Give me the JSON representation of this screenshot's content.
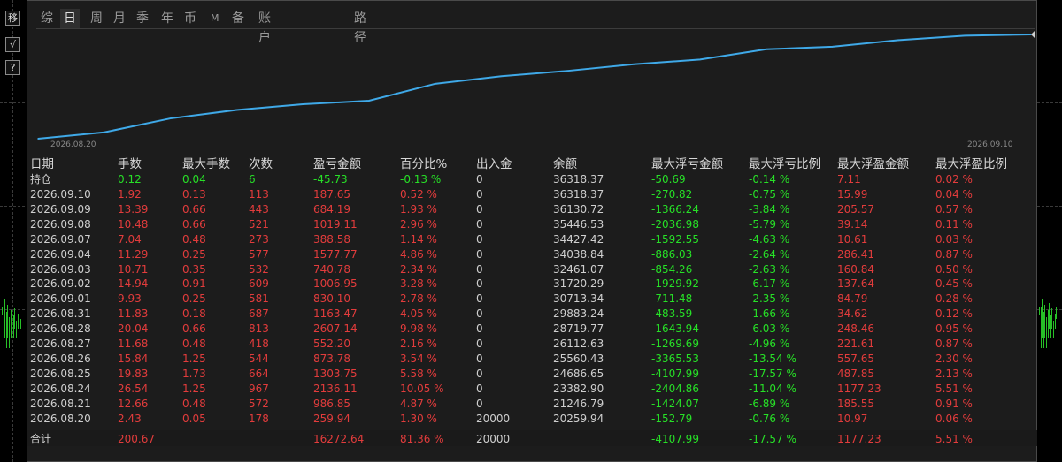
{
  "tabs": [
    "综",
    "日",
    "周",
    "月",
    "季",
    "年",
    "币",
    "M",
    "备",
    "账户",
    "路径"
  ],
  "active_tab": "日",
  "side_icons": [
    "移",
    "√",
    "?"
  ],
  "chart_data": {
    "type": "line",
    "x": [
      "2026.08.20",
      "2026.08.21",
      "2026.08.24",
      "2026.08.25",
      "2026.08.26",
      "2026.08.27",
      "2026.08.28",
      "2026.08.31",
      "2026.09.01",
      "2026.09.02",
      "2026.09.03",
      "2026.09.04",
      "2026.09.07",
      "2026.09.08",
      "2026.09.09",
      "2026.09.10"
    ],
    "values": [
      20259.94,
      21246.79,
      23382.9,
      24686.65,
      25560.43,
      26112.63,
      28719.77,
      29883.24,
      30713.34,
      31720.29,
      32461.07,
      34038.84,
      34427.42,
      35446.53,
      36130.72,
      36318.37
    ],
    "x_start_label": "2026.08.20",
    "x_end_label": "2026.09.10",
    "color": "#3fa9e8"
  },
  "table": {
    "headers": [
      "日期",
      "手数",
      "最大手数",
      "次数",
      "盈亏金额",
      "百分比%",
      "出入金",
      "余额",
      "最大浮亏金额",
      "最大浮亏比例",
      "最大浮盈金额",
      "最大浮盈比例"
    ],
    "position_row": [
      "持仓",
      "0.12",
      "0.04",
      "6",
      "-45.73",
      "-0.13 %",
      "0",
      "36318.37",
      "-50.69",
      "-0.14 %",
      "7.11",
      "0.02 %"
    ],
    "rows": [
      [
        "2026.09.10",
        "1.92",
        "0.13",
        "113",
        "187.65",
        "0.52 %",
        "0",
        "36318.37",
        "-270.82",
        "-0.75 %",
        "15.99",
        "0.04 %"
      ],
      [
        "2026.09.09",
        "13.39",
        "0.66",
        "443",
        "684.19",
        "1.93 %",
        "0",
        "36130.72",
        "-1366.24",
        "-3.84 %",
        "205.57",
        "0.57 %"
      ],
      [
        "2026.09.08",
        "10.48",
        "0.66",
        "521",
        "1019.11",
        "2.96 %",
        "0",
        "35446.53",
        "-2036.98",
        "-5.79 %",
        "39.14",
        "0.11 %"
      ],
      [
        "2026.09.07",
        "7.04",
        "0.48",
        "273",
        "388.58",
        "1.14 %",
        "0",
        "34427.42",
        "-1592.55",
        "-4.63 %",
        "10.61",
        "0.03 %"
      ],
      [
        "2026.09.04",
        "11.29",
        "0.25",
        "577",
        "1577.77",
        "4.86 %",
        "0",
        "34038.84",
        "-886.03",
        "-2.64 %",
        "286.41",
        "0.87 %"
      ],
      [
        "2026.09.03",
        "10.71",
        "0.35",
        "532",
        "740.78",
        "2.34 %",
        "0",
        "32461.07",
        "-854.26",
        "-2.63 %",
        "160.84",
        "0.50 %"
      ],
      [
        "2026.09.02",
        "14.94",
        "0.91",
        "609",
        "1006.95",
        "3.28 %",
        "0",
        "31720.29",
        "-1929.92",
        "-6.17 %",
        "137.64",
        "0.45 %"
      ],
      [
        "2026.09.01",
        "9.93",
        "0.25",
        "581",
        "830.10",
        "2.78 %",
        "0",
        "30713.34",
        "-711.48",
        "-2.35 %",
        "84.79",
        "0.28 %"
      ],
      [
        "2026.08.31",
        "11.83",
        "0.18",
        "687",
        "1163.47",
        "4.05 %",
        "0",
        "29883.24",
        "-483.59",
        "-1.66 %",
        "34.62",
        "0.12 %"
      ],
      [
        "2026.08.28",
        "20.04",
        "0.66",
        "813",
        "2607.14",
        "9.98 %",
        "0",
        "28719.77",
        "-1643.94",
        "-6.03 %",
        "248.46",
        "0.95 %"
      ],
      [
        "2026.08.27",
        "11.68",
        "0.48",
        "418",
        "552.20",
        "2.16 %",
        "0",
        "26112.63",
        "-1269.69",
        "-4.96 %",
        "221.61",
        "0.87 %"
      ],
      [
        "2026.08.26",
        "15.84",
        "1.25",
        "544",
        "873.78",
        "3.54 %",
        "0",
        "25560.43",
        "-3365.53",
        "-13.54 %",
        "557.65",
        "2.30 %"
      ],
      [
        "2026.08.25",
        "19.83",
        "1.73",
        "664",
        "1303.75",
        "5.58 %",
        "0",
        "24686.65",
        "-4107.99",
        "-17.57 %",
        "487.85",
        "2.13 %"
      ],
      [
        "2026.08.24",
        "26.54",
        "1.25",
        "967",
        "2136.11",
        "10.05 %",
        "0",
        "23382.90",
        "-2404.86",
        "-11.04 %",
        "1177.23",
        "5.51 %"
      ],
      [
        "2026.08.21",
        "12.66",
        "0.48",
        "572",
        "986.85",
        "4.87 %",
        "0",
        "21246.79",
        "-1424.07",
        "-6.89 %",
        "185.55",
        "0.91 %"
      ],
      [
        "2026.08.20",
        "2.43",
        "0.05",
        "178",
        "259.94",
        "1.30 %",
        "20000",
        "20259.94",
        "-152.79",
        "-0.76 %",
        "10.97",
        "0.06 %"
      ]
    ],
    "total_row": [
      "合计",
      "200.67",
      "",
      "",
      "16272.64",
      "81.36 %",
      "20000",
      "",
      "-4107.99",
      "-17.57 %",
      "1177.23",
      "5.51 %"
    ]
  }
}
